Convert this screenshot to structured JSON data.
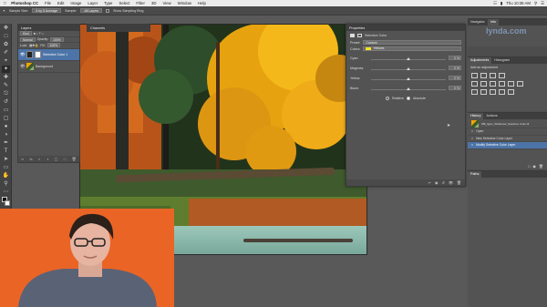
{
  "menubar": {
    "app": "Photoshop CC",
    "items": [
      "File",
      "Edit",
      "Image",
      "Layer",
      "Type",
      "Select",
      "Filter",
      "3D",
      "View",
      "Window",
      "Help"
    ],
    "clock": "Thu 10:38 AM"
  },
  "options_bar": {
    "sample_size_label": "Sample Size:",
    "sample_size_value": "5 by 5 Average",
    "sample_label": "Sample:",
    "sample_value": "All Layers",
    "show_ring_label": "Show Sampling Ring"
  },
  "layers_panel": {
    "title": "Layers",
    "kind_filter": "Kind",
    "blend_mode": "Normal",
    "opacity_label": "Opacity:",
    "opacity_value": "100%",
    "lock_label": "Lock:",
    "fill_label": "Fill:",
    "fill_value": "100%",
    "layers": [
      {
        "name": "Selective Color 1",
        "selected": true
      },
      {
        "name": "Background",
        "selected": false
      }
    ]
  },
  "channels_panel": {
    "title": "Channels"
  },
  "properties_panel": {
    "title": "Properties",
    "adjustment_name": "Selective Color",
    "preset_label": "Preset:",
    "preset_value": "Custom",
    "colors_label": "Colors:",
    "colors_value": "Yellows",
    "colors_swatch": "#f5e21a",
    "sliders": [
      {
        "label": "Cyan:",
        "value": "0 %",
        "level": 0.5
      },
      {
        "label": "Magenta:",
        "value": "0 %",
        "level": 0.5
      },
      {
        "label": "Yellow:",
        "value": "0 %",
        "level": 0.5
      },
      {
        "label": "Black:",
        "value": "0 %",
        "level": 0.5
      }
    ],
    "relative_label": "Relative",
    "absolute_label": "Absolute"
  },
  "right_panels": {
    "top_tabs": [
      "Navigator",
      "Info"
    ],
    "adjust_tabs": [
      "Adjustments",
      "Histogram"
    ],
    "add_adjustment": "Add an adjustment",
    "history_tabs": [
      "History",
      "Actions"
    ],
    "history_file": "MB_Ilgen_Shattered_Selective Color.tif",
    "history_items": [
      {
        "name": "Open",
        "selected": false
      },
      {
        "name": "New Selective Color Layer",
        "selected": false
      },
      {
        "name": "Modify Selective Color Layer",
        "selected": true
      }
    ],
    "paths_title": "Paths"
  },
  "watermark": "lynda.com",
  "accent": "#4c74a8",
  "webcam_bg": "#ea6426"
}
